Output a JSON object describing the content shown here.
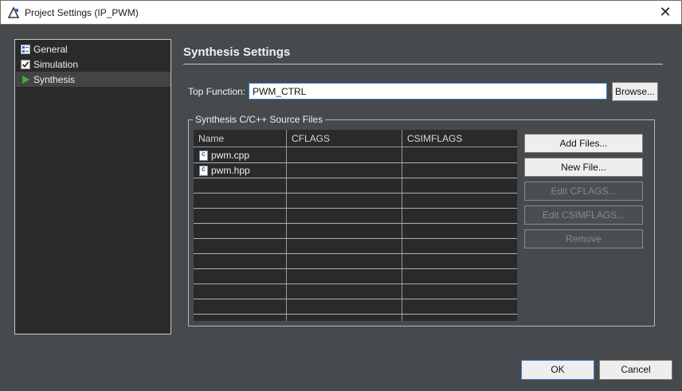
{
  "window": {
    "title": "Project Settings (IP_PWM)",
    "close_glyph": "✕",
    "icon": "vitis-hls-app-icon"
  },
  "nav": {
    "items": [
      {
        "label": "General",
        "icon": "general-icon",
        "selected": false
      },
      {
        "label": "Simulation",
        "icon": "checkbox-checked-icon",
        "selected": false
      },
      {
        "label": "Synthesis",
        "icon": "run-arrow-icon",
        "selected": true
      }
    ]
  },
  "main": {
    "section_title": "Synthesis Settings",
    "top_function": {
      "label": "Top Function:",
      "value": "PWM_CTRL"
    },
    "browse_label": "Browse...",
    "source_group": {
      "title": "Synthesis C/C++ Source Files",
      "columns": [
        "Name",
        "CFLAGS",
        "CSIMFLAGS"
      ],
      "rows": [
        {
          "name": "pwm.cpp",
          "cflags": "",
          "csimflags": ""
        },
        {
          "name": "pwm.hpp",
          "cflags": "",
          "csimflags": ""
        }
      ]
    },
    "buttons": {
      "add_files": "Add Files...",
      "new_file": "New File...",
      "edit_cflags": "Edit CFLAGS...",
      "edit_csimflags": "Edit CSIMFLAGS...",
      "remove": "Remove"
    }
  },
  "footer": {
    "ok": "OK",
    "cancel": "Cancel"
  },
  "colors": {
    "background": "#464a4d",
    "panel": "#2a2a2a",
    "focus": "#3a7bd5"
  }
}
